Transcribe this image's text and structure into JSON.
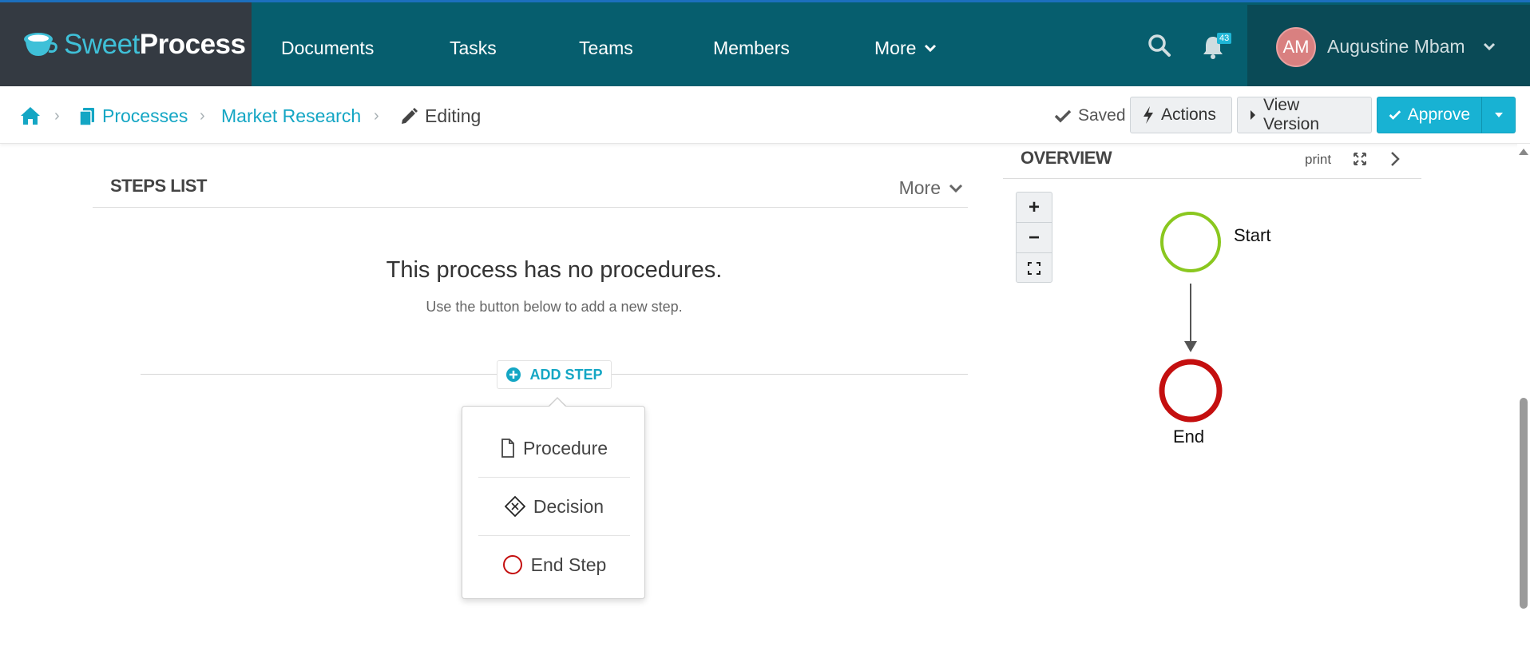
{
  "app": {
    "logo_sweet": "Sweet",
    "logo_process": "Process"
  },
  "nav": {
    "items": [
      {
        "label": "Documents"
      },
      {
        "label": "Tasks"
      },
      {
        "label": "Teams"
      },
      {
        "label": "Members"
      },
      {
        "label": "More"
      }
    ],
    "notifications_count": "43",
    "user": {
      "initials": "AM",
      "name": "Augustine Mbam"
    }
  },
  "breadcrumb": {
    "items": [
      {
        "label": "Processes"
      },
      {
        "label": "Market Research"
      },
      {
        "label": "Editing"
      }
    ],
    "saved_label": "Saved",
    "actions_label": "Actions",
    "view_version_label": "View Version",
    "approve_label": "Approve"
  },
  "steps": {
    "title": "STEPS LIST",
    "more_label": "More",
    "empty_title": "This process has no procedures.",
    "empty_subtitle": "Use the button below to add a new step.",
    "add_step_label": "ADD STEP",
    "menu": [
      {
        "label": "Procedure",
        "icon": "document-icon"
      },
      {
        "label": "Decision",
        "icon": "decision-diamond-icon"
      },
      {
        "label": "End Step",
        "icon": "end-circle-icon"
      }
    ]
  },
  "overview": {
    "title": "OVERVIEW",
    "print_label": "print",
    "zoom_in": "+",
    "zoom_out": "−",
    "start_label": "Start",
    "end_label": "End"
  },
  "colors": {
    "nav_bg": "#065e6e",
    "accent": "#14a6c4",
    "start_node": "#8ac71f",
    "end_node": "#c40f0f"
  }
}
